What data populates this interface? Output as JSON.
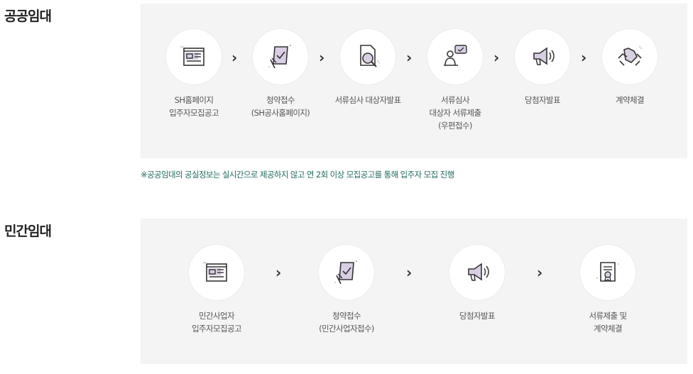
{
  "public": {
    "title": "공공임대",
    "steps": [
      {
        "label": "SH홈페이지\n입주자모집공고",
        "icon": "notice-document-icon"
      },
      {
        "label": "청약접수\n(SH공사홈페이지)",
        "icon": "application-check-icon"
      },
      {
        "label": "서류심사 대상자발표",
        "icon": "document-search-icon"
      },
      {
        "label": "서류심사\n대상자 서류제출\n(우편접수)",
        "icon": "person-chat-icon"
      },
      {
        "label": "당첨자발표",
        "icon": "megaphone-icon"
      },
      {
        "label": "계약체결",
        "icon": "handshake-icon"
      }
    ],
    "arrow": "›",
    "note": "※공공임대의 공실정보는 실시간으로 제공하지 않고 연 2회 이상 모집공고를 통해 입주자 모집 진행"
  },
  "private": {
    "title": "민간임대",
    "steps": [
      {
        "label": "민간사업자\n입주자모집공고",
        "icon": "notice-document-icon"
      },
      {
        "label": "청약접수\n(민간사업자접수)",
        "icon": "application-check-icon"
      },
      {
        "label": "당첨자발표",
        "icon": "megaphone-icon"
      },
      {
        "label": "서류제출 및\n계약체결",
        "icon": "contract-scroll-icon"
      }
    ],
    "arrow": "›"
  },
  "colors": {
    "accent": "#d9cfe4",
    "line": "#333333",
    "panel": "#f4f4f4",
    "note": "#1f6b5f"
  }
}
